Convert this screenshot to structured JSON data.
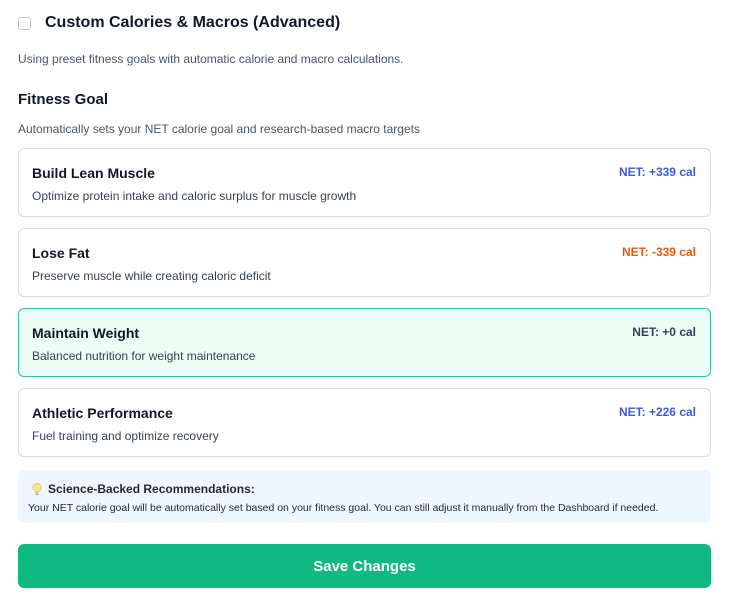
{
  "custom_toggle": {
    "label": "Custom Calories & Macros (Advanced)",
    "checked": false
  },
  "preset_note": "Using preset fitness goals with automatic calorie and macro calculations.",
  "fitness_goal": {
    "title": "Fitness Goal",
    "subtitle": "Automatically sets your NET calorie goal and research-based macro targets",
    "options": [
      {
        "name": "Build Lean Muscle",
        "description": "Optimize protein intake and caloric surplus for muscle growth",
        "net": "NET: +339 cal",
        "net_color": "#3b5bdb",
        "selected": false
      },
      {
        "name": "Lose Fat",
        "description": "Preserve muscle while creating caloric deficit",
        "net": "NET: -339 cal",
        "net_color": "#e8590c",
        "selected": false
      },
      {
        "name": "Maintain Weight",
        "description": "Balanced nutrition for weight maintenance",
        "net": "NET: +0 cal",
        "net_color": "#374151",
        "selected": true
      },
      {
        "name": "Athletic Performance",
        "description": "Fuel training and optimize recovery",
        "net": "NET: +226 cal",
        "net_color": "#3b5bdb",
        "selected": false
      }
    ]
  },
  "info": {
    "icon": "lightbulb-icon",
    "title": "Science-Backed Recommendations:",
    "body": "Your NET calorie goal will be automatically set based on your fitness goal. You can still adjust it manually from the Dashboard if needed."
  },
  "save_button": {
    "label": "Save Changes"
  },
  "colors": {
    "accent": "#10b981",
    "selected_bg": "#ecfdf5",
    "selected_border": "#34c38f",
    "info_bg": "#eff6ff"
  }
}
